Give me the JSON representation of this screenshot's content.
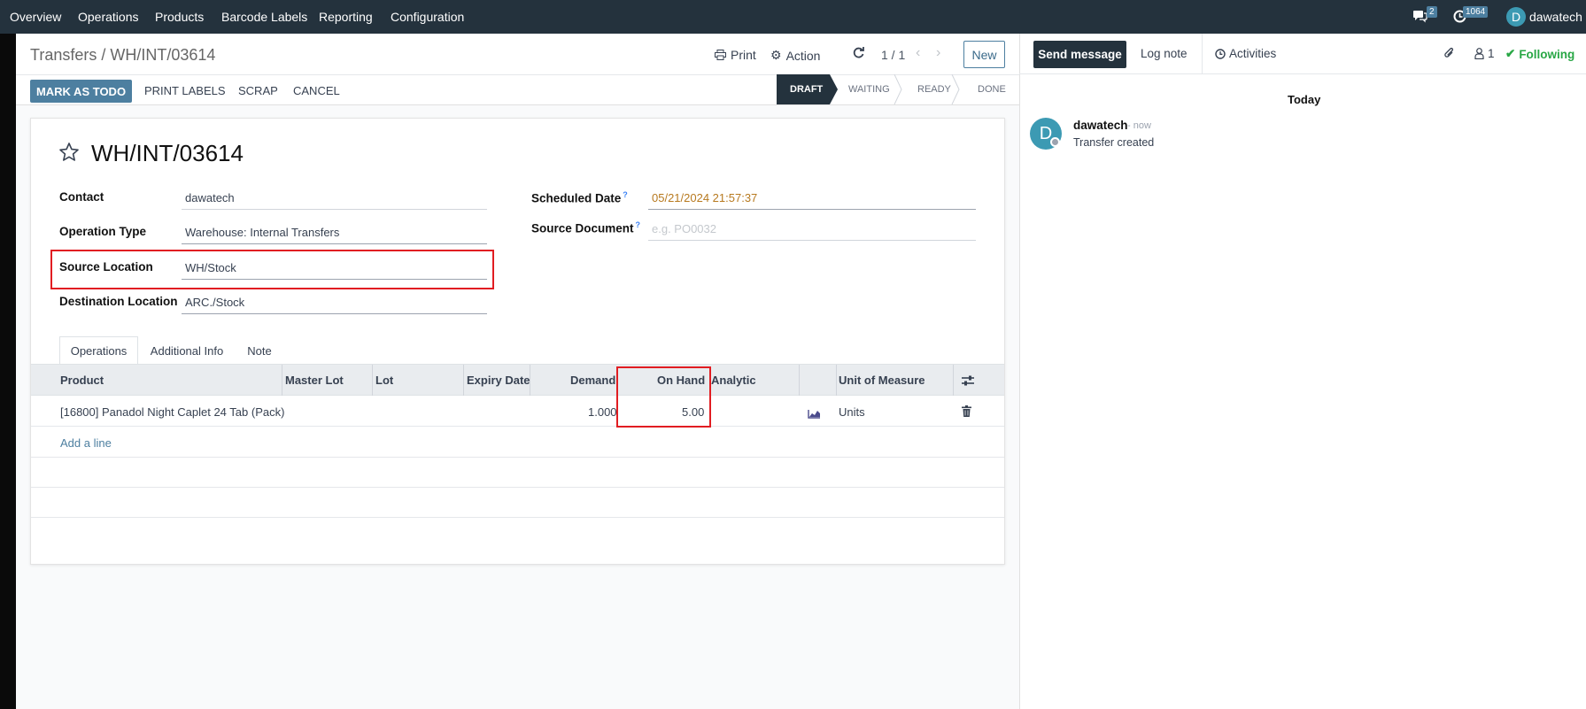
{
  "navbar": {
    "items": [
      "Overview",
      "Operations",
      "Products",
      "Barcode Labels",
      "Reporting",
      "Configuration"
    ],
    "messages_count": "2",
    "activities_count": "1064",
    "user_initial": "D",
    "user_name": "dawatech"
  },
  "control_panel": {
    "breadcrumb": "Transfers / WH/INT/03614",
    "print_label": "Print",
    "action_label": "Action",
    "pager": "1 / 1",
    "new_label": "New"
  },
  "buttons": {
    "mark_todo": "MARK AS TODO",
    "print_labels": "PRINT LABELS",
    "scrap": "SCRAP",
    "cancel": "CANCEL"
  },
  "status": {
    "stages": [
      "DRAFT",
      "WAITING",
      "READY",
      "DONE"
    ],
    "active": "DRAFT"
  },
  "form": {
    "title": "WH/INT/03614",
    "contact_label": "Contact",
    "contact_value": "dawatech",
    "operation_type_label": "Operation Type",
    "operation_type_value": "Warehouse: Internal Transfers",
    "source_location_label": "Source Location",
    "source_location_value": "WH/Stock",
    "destination_location_label": "Destination Location",
    "destination_location_value": "ARC./Stock",
    "scheduled_date_label": "Scheduled Date",
    "scheduled_date_value": "05/21/2024 21:57:37",
    "source_document_label": "Source Document",
    "source_document_placeholder": "e.g. PO0032",
    "help_mark": "?"
  },
  "tabs": [
    "Operations",
    "Additional Info",
    "Note"
  ],
  "table": {
    "headers": {
      "product": "Product",
      "master_lot": "Master Lot",
      "lot": "Lot",
      "expiry": "Expiry Date",
      "demand": "Demand",
      "on_hand": "On Hand",
      "analytic": "Analytic",
      "uom": "Unit of Measure"
    },
    "rows": [
      {
        "product": "[16800] Panadol Night Caplet 24 Tab (Pack)",
        "demand": "1.000",
        "on_hand": "5.00",
        "uom": "Units"
      }
    ],
    "add_line": "Add a line"
  },
  "chatter": {
    "send_message": "Send message",
    "log_note": "Log note",
    "activities": "Activities",
    "followers_count": "1",
    "following": "Following",
    "today": "Today",
    "message": {
      "author": "dawatech",
      "time": "- now",
      "body": "Transfer created",
      "initial": "D"
    }
  },
  "colors": {
    "navbar": "#24323d",
    "primary": "#4d7fa0",
    "highlight_box": "#e11d22",
    "scheduled_date": "#b7791f",
    "following": "#28a745"
  }
}
